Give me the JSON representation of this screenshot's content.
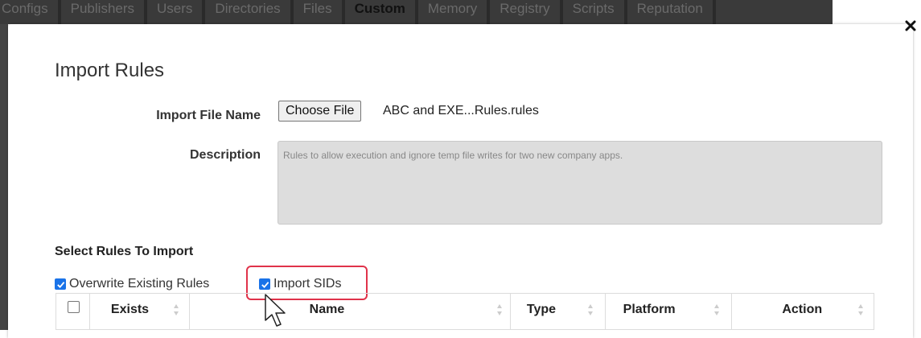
{
  "background_tabs": [
    "Configs",
    "Publishers",
    "Users",
    "Directories",
    "Files",
    "Custom",
    "Memory",
    "Registry",
    "Scripts",
    "Reputation"
  ],
  "background_active_tab": "Custom",
  "modal": {
    "title": "Import Rules",
    "close_icon": "close-icon",
    "import_file_label": "Import File Name",
    "choose_file_label": "Choose File",
    "file_name": "ABC and EXE...Rules.rules",
    "description_label": "Description",
    "description_value": "Rules to allow execution and ignore temp file writes for two new company apps.",
    "select_rules_title": "Select Rules To Import",
    "overwrite_label": "Overwrite Existing Rules",
    "overwrite_checked": true,
    "import_sids_label": "Import SIDs",
    "import_sids_checked": true,
    "table": {
      "columns": [
        "Exists",
        "Name",
        "Type",
        "Platform",
        "Action"
      ]
    }
  },
  "colors": {
    "checkbox_accent": "#1a73e8",
    "highlight": "#e0334a",
    "description_bg": "#dddddd"
  }
}
